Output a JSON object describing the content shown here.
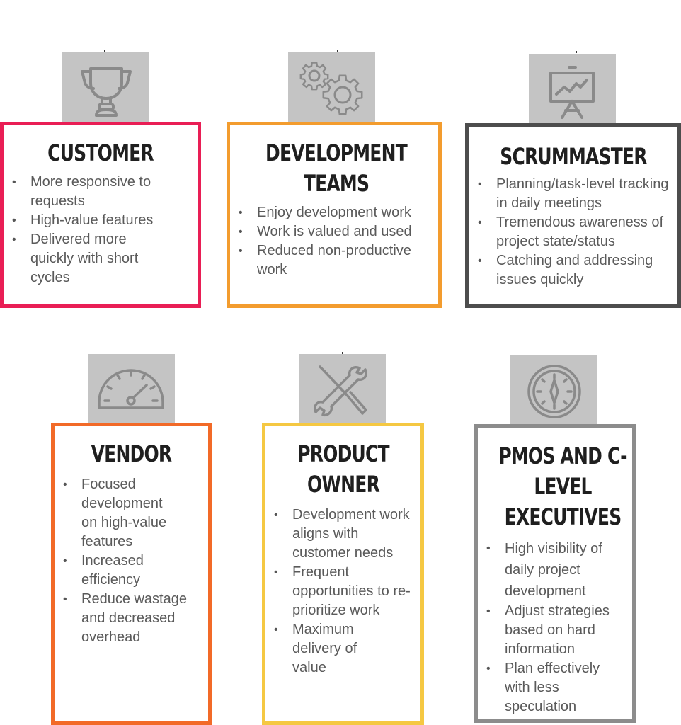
{
  "colors": {
    "customer": "#e91e55",
    "development_teams": "#f39c2e",
    "scrummaster": "#4d4d4d",
    "vendor": "#f26a28",
    "product_owner": "#f5c842",
    "pmos": "#8c8c8c",
    "icon_bg": "#c4c4c4",
    "icon_stroke": "#8a8a8a"
  },
  "cards": [
    {
      "id": "customer",
      "icon": "trophy-icon",
      "title": "CUSTOMER",
      "bullets": [
        "More responsive to requests",
        "High-value features",
        "Delivered more quickly with short cycles"
      ]
    },
    {
      "id": "development-teams",
      "icon": "gears-icon",
      "title": "DEVELOPMENT TEAMS",
      "bullets": [
        "Enjoy development work",
        "Work is valued and used",
        "Reduced non-productive work"
      ]
    },
    {
      "id": "scrummaster",
      "icon": "presentation-chart-icon",
      "title": "SCRUMMASTER",
      "bullets": [
        "Planning/task-level tracking in daily meetings",
        "Tremendous awareness of project state/status",
        "Catching and addressing issues quickly"
      ]
    },
    {
      "id": "vendor",
      "icon": "speedometer-icon",
      "title": "VENDOR",
      "bullets": [
        "Focused development on high-value features",
        "Increased efficiency",
        "Reduce wastage and decreased overhead"
      ]
    },
    {
      "id": "product-owner",
      "icon": "tools-icon",
      "title": "PRODUCT OWNER",
      "bullets": [
        "Development work aligns with customer needs",
        "Frequent opportunities to re-prioritize work",
        "Maximum delivery of value"
      ]
    },
    {
      "id": "pmos",
      "icon": "compass-icon",
      "title": "PMOS AND C-LEVEL EXECUTIVES",
      "bullets": [
        "High visibility of daily project development",
        "Adjust strategies based on hard information",
        "Plan effectively with less speculation"
      ]
    }
  ]
}
